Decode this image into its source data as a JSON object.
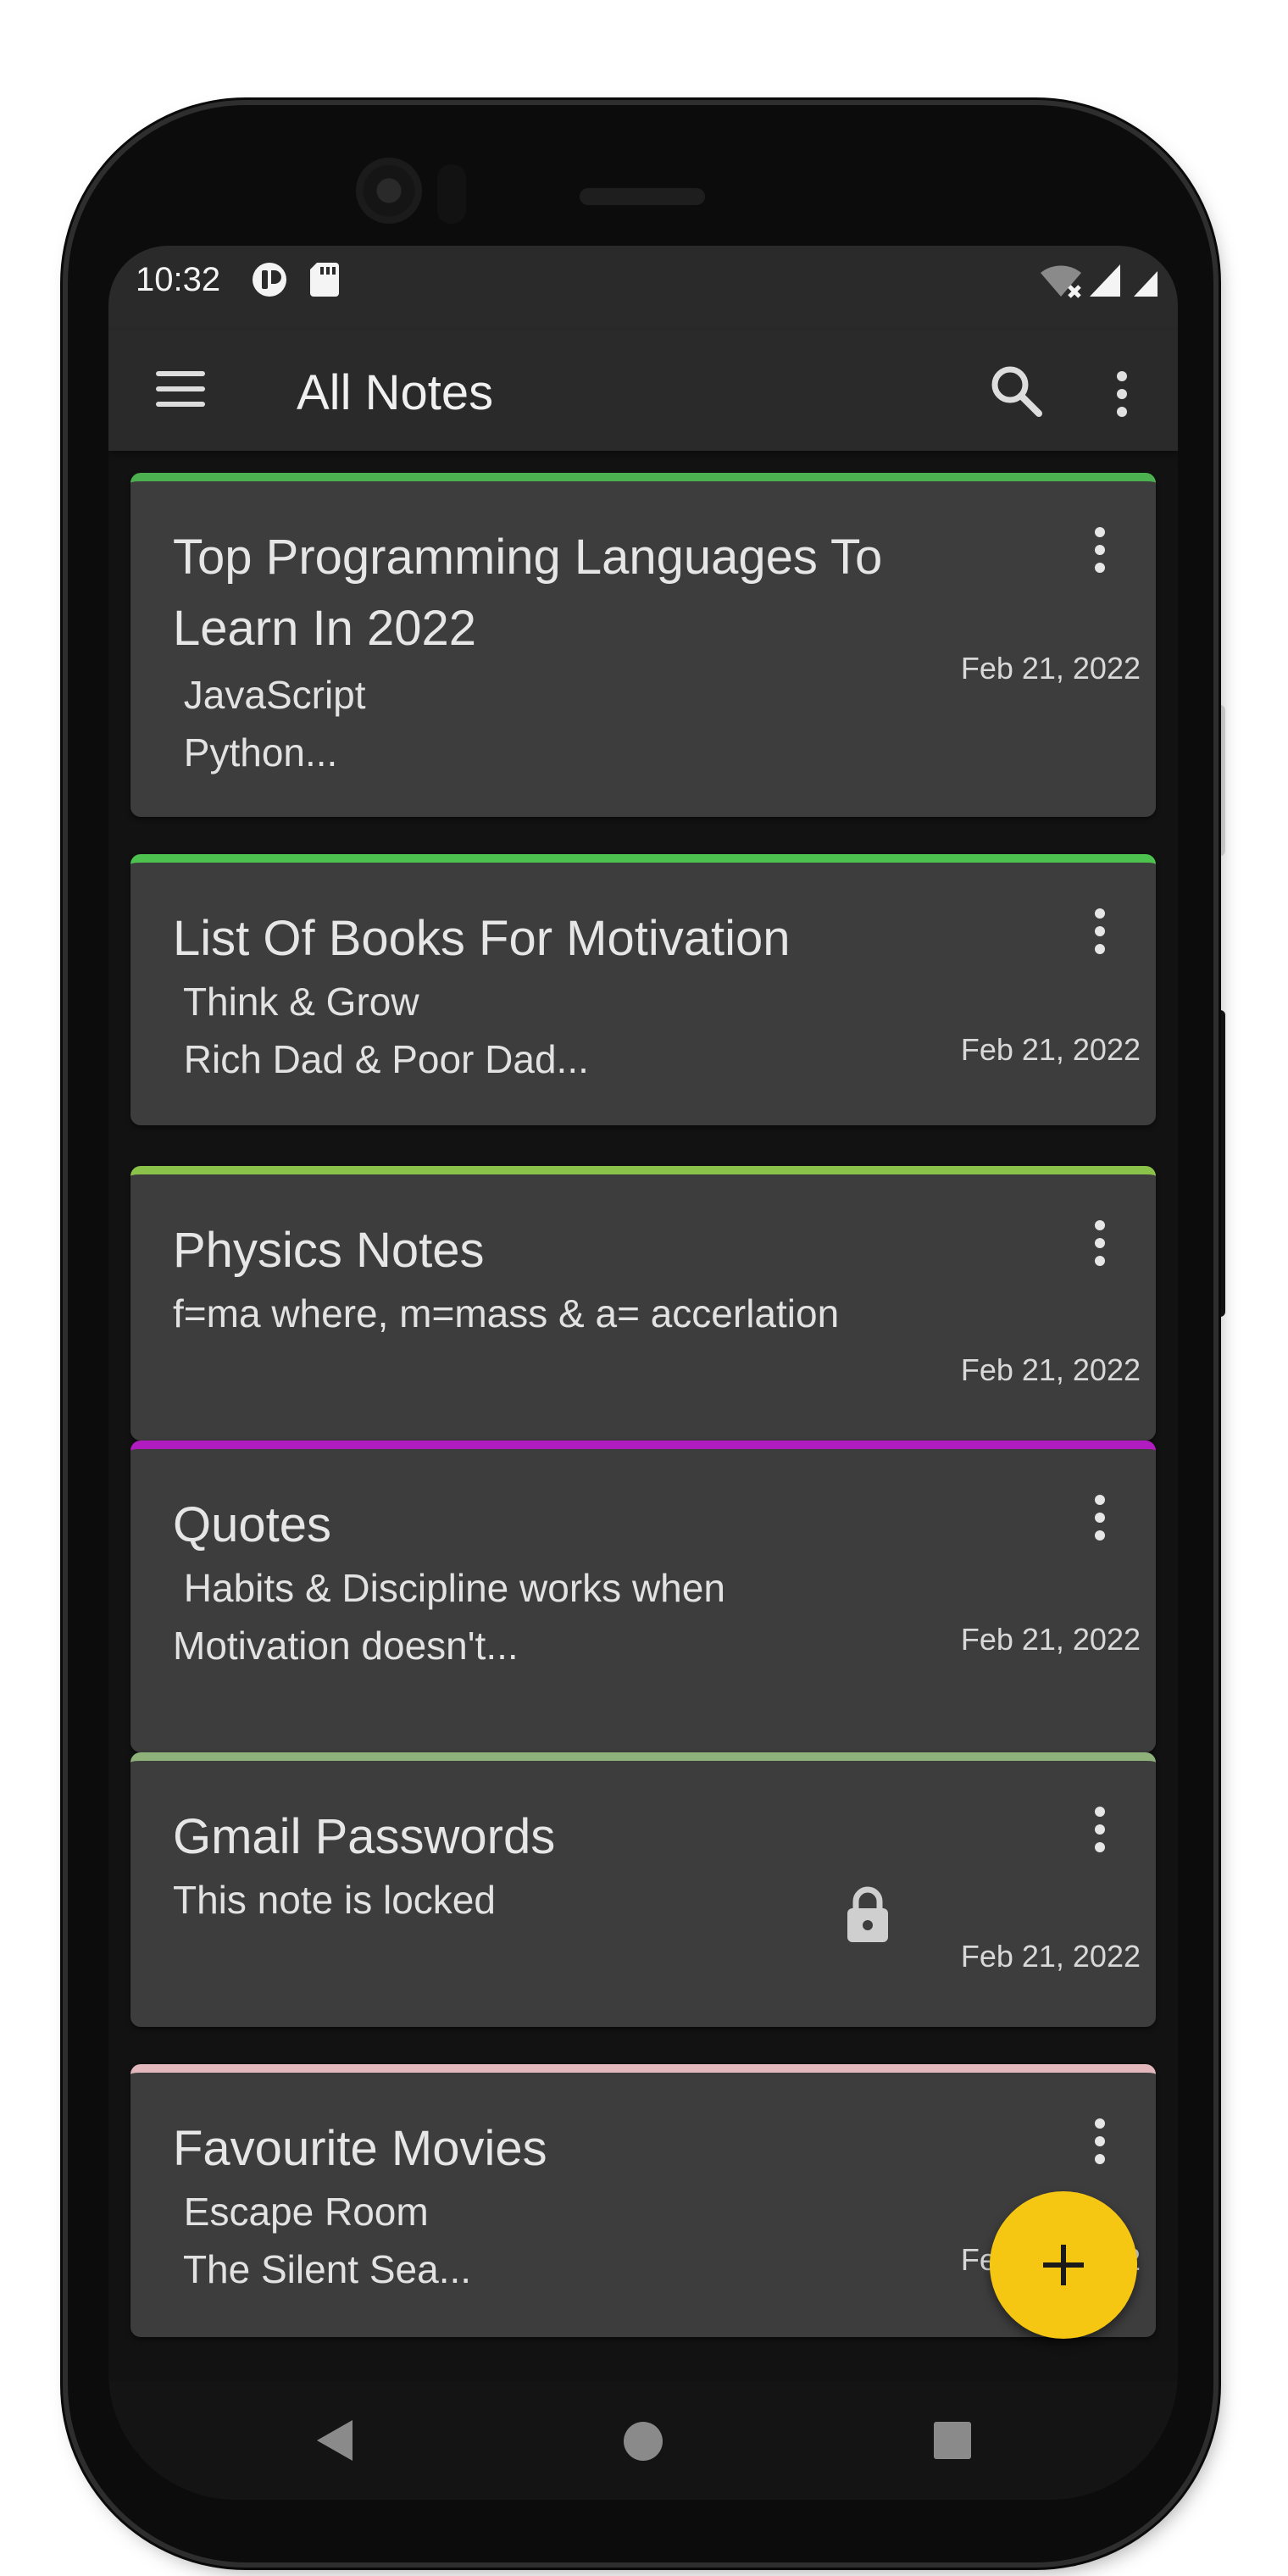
{
  "status_bar": {
    "time": "10:32",
    "icons": [
      "nfc-icon",
      "sd-card-icon",
      "wifi-icon",
      "signal-icon",
      "battery-icon"
    ]
  },
  "app_bar": {
    "title": "All Notes",
    "icons": [
      "menu-icon",
      "search-icon",
      "more-vert-icon"
    ]
  },
  "notes": [
    {
      "title": "Top Programming Languages To Learn In 2022",
      "body": " JavaScript\n Python...",
      "date": "Feb 21, 2022",
      "accent": "#4caf50",
      "locked": false
    },
    {
      "title": "List Of Books For Motivation",
      "body": " Think & Grow\n Rich Dad & Poor Dad...",
      "date": "Feb 21, 2022",
      "accent": "#4ec24e",
      "locked": false
    },
    {
      "title": "Physics Notes",
      "body": "f=ma where, m=mass & a= accerlation",
      "date": "Feb 21, 2022",
      "accent": "#8bc34a",
      "locked": false
    },
    {
      "title": "Quotes",
      "body": " Habits & Discipline works when\nMotivation doesn't...",
      "date": "Feb 21, 2022",
      "accent": "#b01cc0",
      "locked": false
    },
    {
      "title": "Gmail Passwords",
      "body": "This note is locked",
      "date": "Feb 21, 2022",
      "accent": "#8fb27a",
      "locked": true
    },
    {
      "title": "Favourite Movies",
      "body": " Escape Room\n The Silent Sea...",
      "date": "Feb 21, 2022",
      "accent": "#e3b8bc",
      "locked": false
    }
  ],
  "fab": {
    "icon": "plus-icon",
    "color": "#f6c712"
  },
  "nav_bar": {
    "icons": [
      "back-icon",
      "home-icon",
      "recents-icon"
    ]
  },
  "colors": {
    "background": "#121212",
    "card": "#3d3d3d",
    "app_bar": "#2a2a2a",
    "text": "#e6e6e6"
  }
}
